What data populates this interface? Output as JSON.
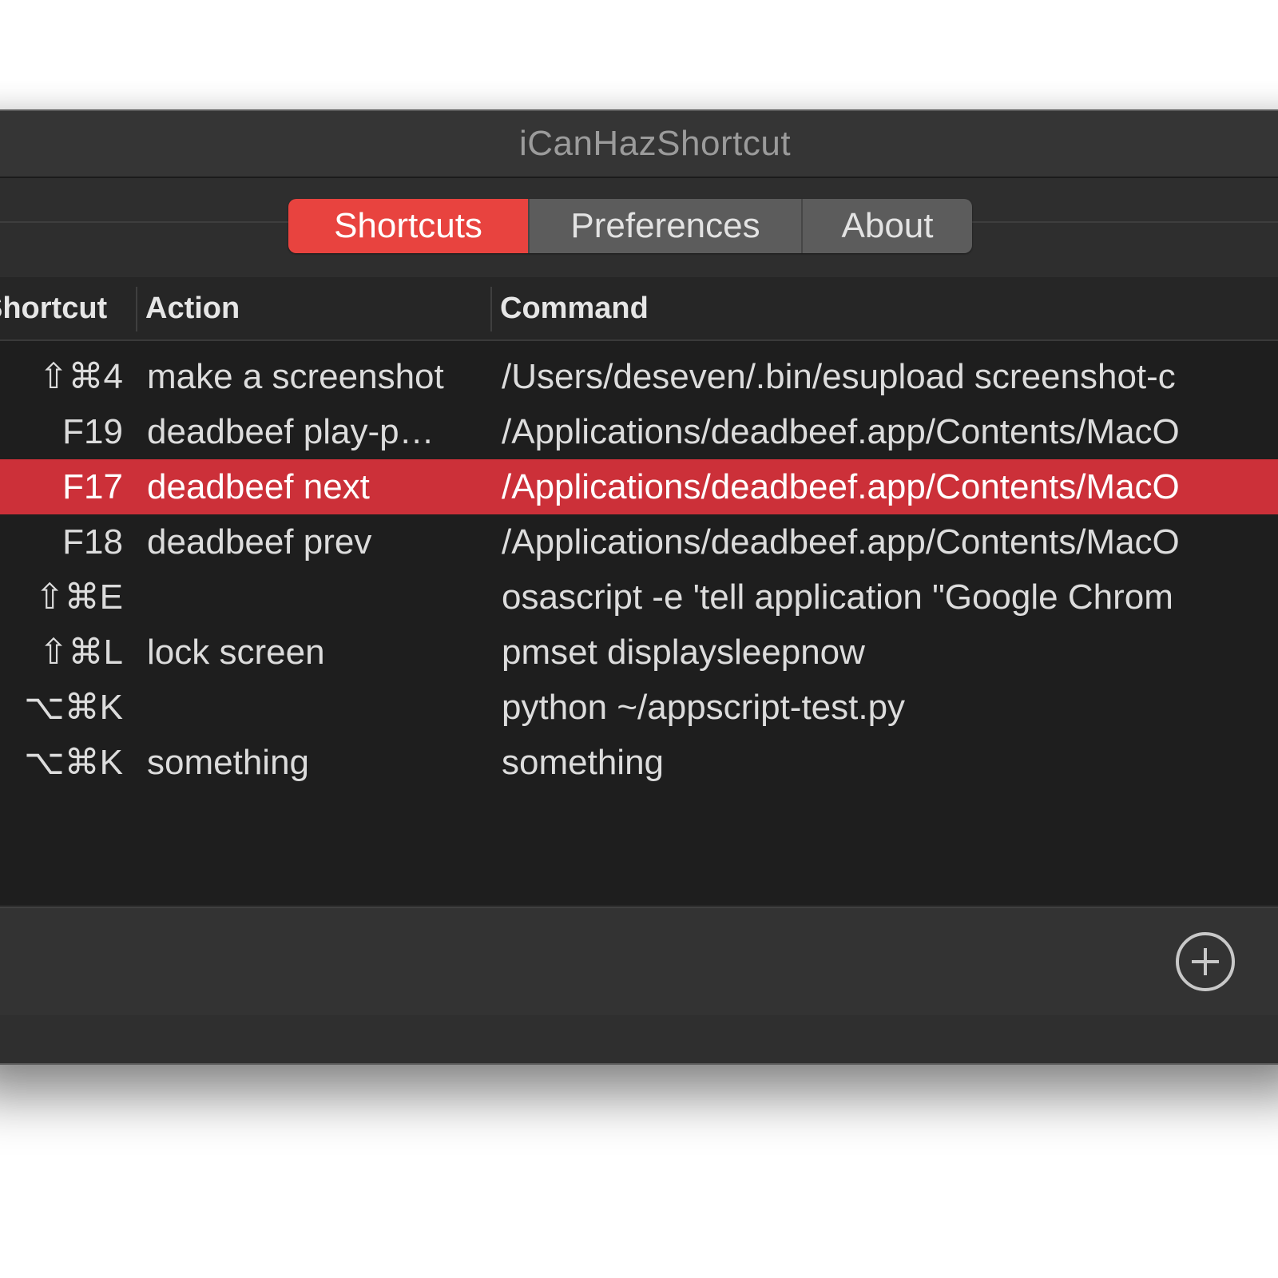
{
  "window": {
    "title": "iCanHazShortcut"
  },
  "tabs": [
    {
      "label": "Shortcuts",
      "active": true
    },
    {
      "label": "Preferences",
      "active": false
    },
    {
      "label": "About",
      "active": false
    }
  ],
  "table": {
    "columns": {
      "shortcut": "Shortcut",
      "action": "Action",
      "command": "Command"
    },
    "rows": [
      {
        "shortcut": "⇧⌘4",
        "action": "make a screenshot",
        "command": "/Users/deseven/.bin/esupload screenshot-c",
        "selected": false
      },
      {
        "shortcut": "F19",
        "action": "deadbeef play-p…",
        "command": "/Applications/deadbeef.app/Contents/MacO",
        "selected": false
      },
      {
        "shortcut": "F17",
        "action": "deadbeef next",
        "command": "/Applications/deadbeef.app/Contents/MacO",
        "selected": true
      },
      {
        "shortcut": "F18",
        "action": "deadbeef prev",
        "command": "/Applications/deadbeef.app/Contents/MacO",
        "selected": false
      },
      {
        "shortcut": "⇧⌘E",
        "action": "",
        "command": "osascript -e 'tell application \"Google Chrom",
        "selected": false
      },
      {
        "shortcut": "⇧⌘L",
        "action": "lock screen",
        "command": "pmset displaysleepnow",
        "selected": false
      },
      {
        "shortcut": "⌥⌘K",
        "action": "",
        "command": "python ~/appscript-test.py",
        "selected": false
      },
      {
        "shortcut": "⌥⌘K",
        "action": "something",
        "command": "something",
        "selected": false
      }
    ]
  },
  "toolbar": {
    "add_icon": "plus-circle-icon"
  },
  "colors": {
    "accent": "#e8433f",
    "selection": "#cc3039",
    "background": "#1e1e1e"
  }
}
